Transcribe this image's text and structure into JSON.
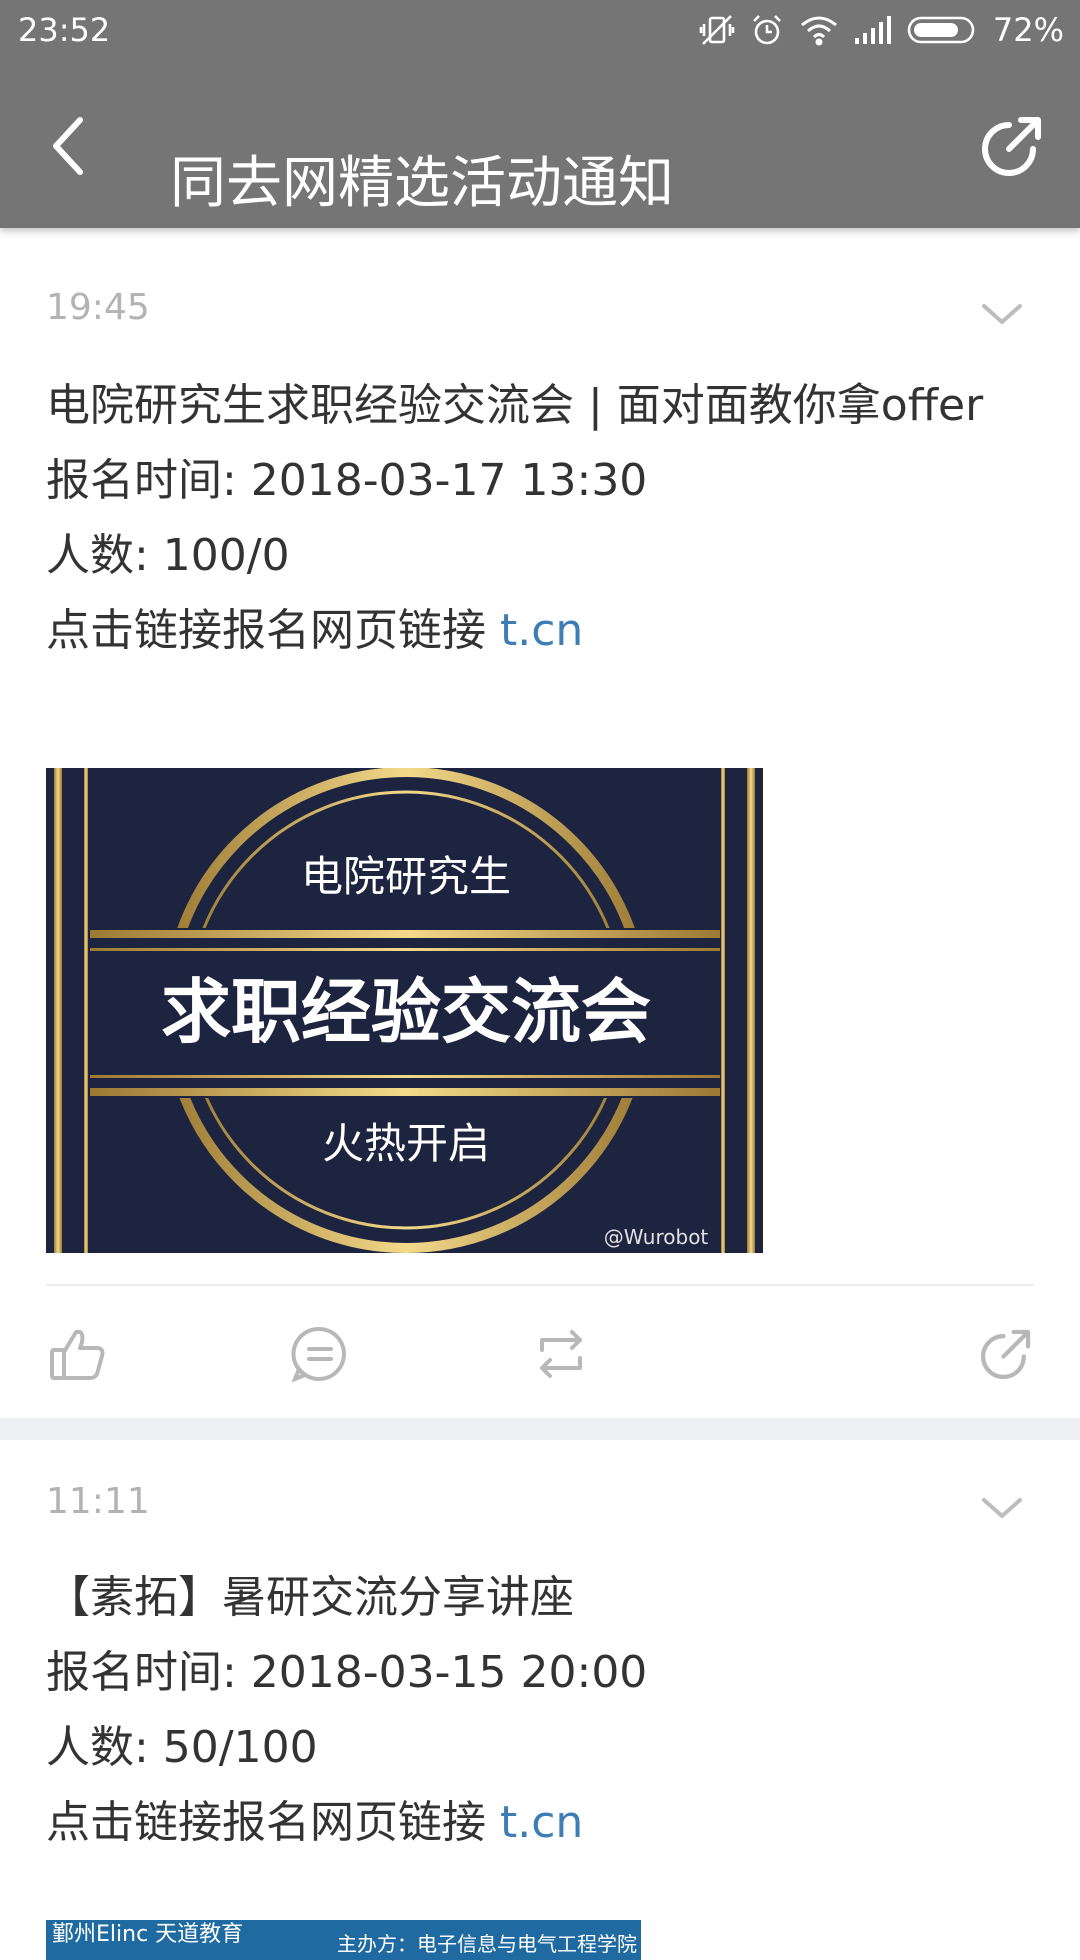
{
  "status_bar": {
    "time": "23:52",
    "battery_percent": "72%",
    "icons": [
      "vibrate-mute-icon",
      "alarm-icon",
      "wifi-icon",
      "signal-icon",
      "battery-icon"
    ]
  },
  "title_bar": {
    "title": "同去网精选活动通知",
    "back_icon": "back-arrow-icon",
    "share_icon": "share-icon"
  },
  "posts": [
    {
      "time": "19:45",
      "title": "电院研究生求职经验交流会 | 面对面教你拿offer",
      "signup_time": "报名时间: 2018-03-17 13:30",
      "count": "人数: 100/0",
      "link_prefix": "点击链接报名网页链接 ",
      "link_text": "t.cn",
      "poster": {
        "line1": "电院研究生",
        "line2": "求职经验交流会",
        "line3": "火热开启",
        "watermark": "@Wurobot",
        "bg_color": "#1c2440",
        "gold_color": "#d9b25a"
      },
      "actions": [
        "like-icon",
        "comment-icon",
        "repost-icon",
        "share-icon"
      ]
    },
    {
      "time": "11:11",
      "title": "【素拓】暑研交流分享讲座",
      "signup_time": "报名时间: 2018-03-15 20:00",
      "count": "人数: 50/100",
      "link_prefix": "点击链接报名网页链接 ",
      "link_text": "t.cn",
      "poster": {
        "logo_text": "鄞州Elinc  天道教育",
        "title_text": "主办方：电子信息与电气工程学院"
      }
    }
  ],
  "colors": {
    "toolbar": "#757575",
    "link": "#3b7db4",
    "separator": "#eef0f3"
  }
}
